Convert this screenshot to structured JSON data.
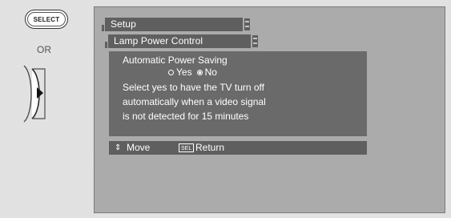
{
  "remote": {
    "select_button": "SELECT",
    "or_label": "OR"
  },
  "menu": {
    "title": "Setup",
    "submenu_title": "Lamp Power Control"
  },
  "setting": {
    "heading": "Automatic Power Saving",
    "options": [
      {
        "label": "Yes",
        "selected": false
      },
      {
        "label": "No",
        "selected": true
      }
    ],
    "description": "Select yes to have the TV turn off\nautomatically when a video signal\nis not detected for 15 minutes"
  },
  "footer": {
    "move_icon": "up-down-arrows-icon",
    "move_label": "Move",
    "sel_key": "SEL",
    "return_label": "Return"
  }
}
